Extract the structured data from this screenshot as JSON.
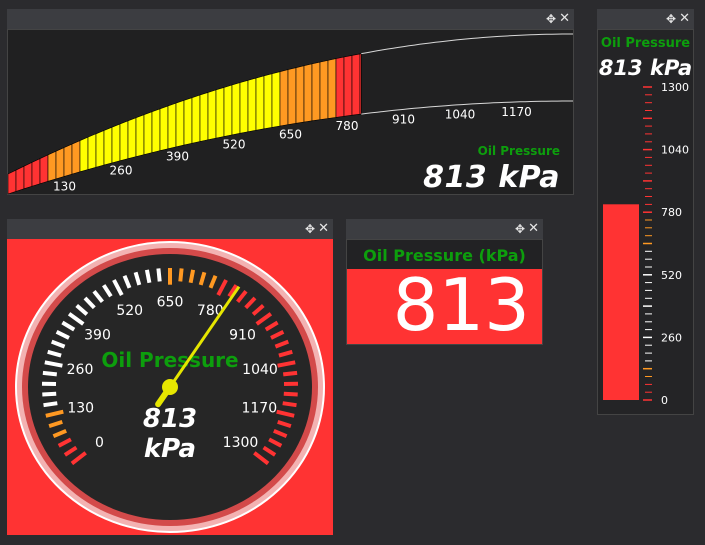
{
  "gauge_label": "Oil Pressure",
  "gauge_value": "813",
  "gauge_value_with_unit": "813 kPa",
  "gauge_unit": "kPa",
  "digital_label": "Oil Pressure (kPa)",
  "scale": {
    "min": 0,
    "max": 1300,
    "value": 813,
    "ticks": [
      "0",
      "130",
      "260",
      "390",
      "520",
      "650",
      "780",
      "910",
      "1040",
      "1170",
      "1300"
    ],
    "arc_ticks": [
      "130",
      "260",
      "390",
      "520",
      "650",
      "780",
      "910",
      "1040",
      "1170"
    ]
  },
  "colors": {
    "accent_green": "#0d9e0d",
    "alarm_red": "#ff3333",
    "warning_orange": "#ff9922",
    "caution_yellow": "#ffff00",
    "needle": "#e6e600"
  },
  "icons": {
    "move": "move-icon",
    "close": "close-icon"
  },
  "titlebar": {
    "move_glyph": "✥",
    "close_glyph": "✕"
  }
}
